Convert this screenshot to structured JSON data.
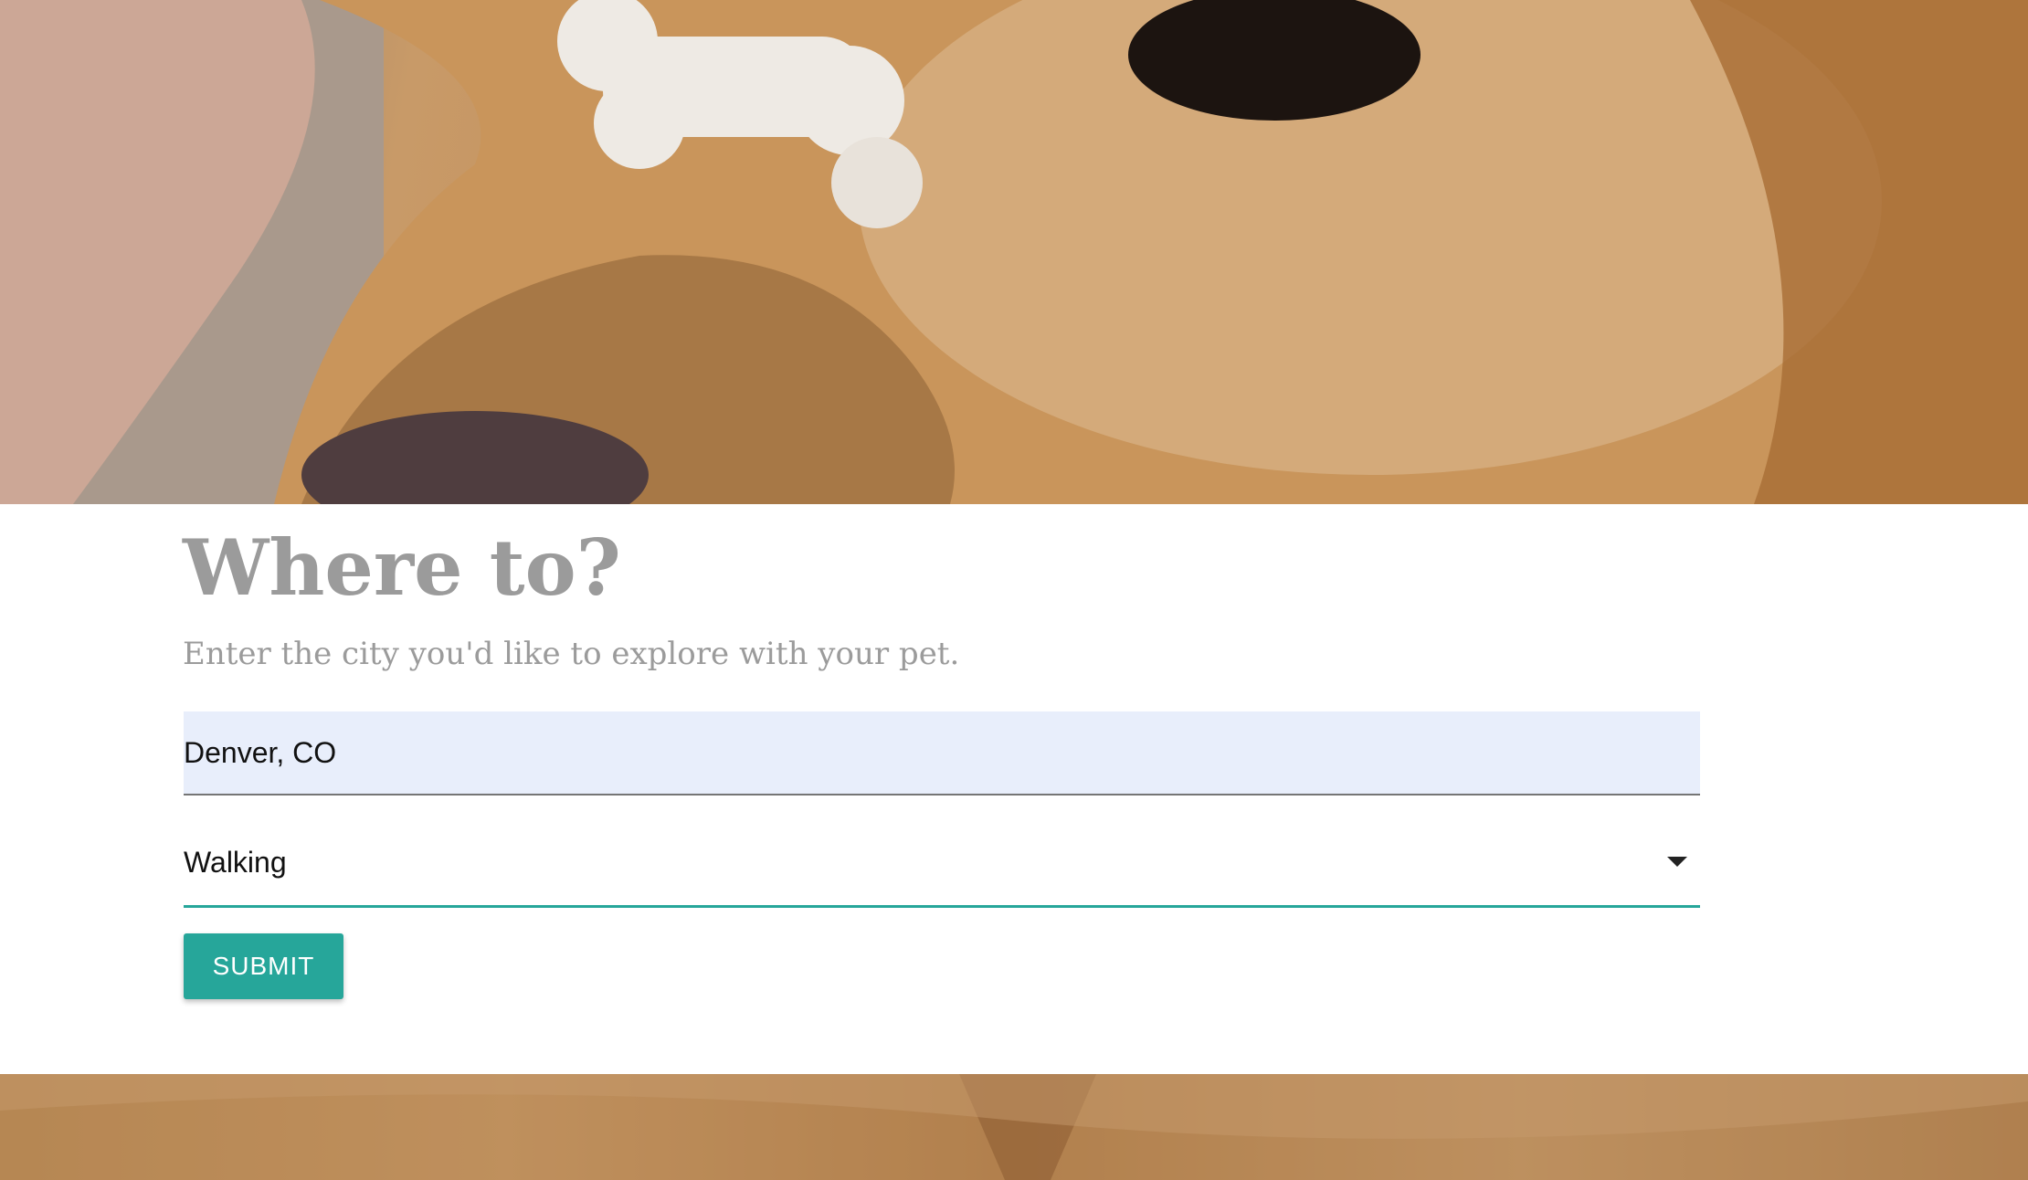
{
  "hero": {
    "image": "golden-retriever-with-bone-treat-photo"
  },
  "form": {
    "title": "Where to?",
    "subtitle": "Enter the city you'd like to explore with your pet.",
    "city_value": "Denver, CO",
    "mode_selected": "Walking",
    "submit_label": "SUBMIT"
  },
  "footer": {
    "image": "dog-fur-photo"
  },
  "colors": {
    "accent": "#26a69a",
    "input_fill": "#e8eefb",
    "heading_text": "#9b9b9b"
  }
}
